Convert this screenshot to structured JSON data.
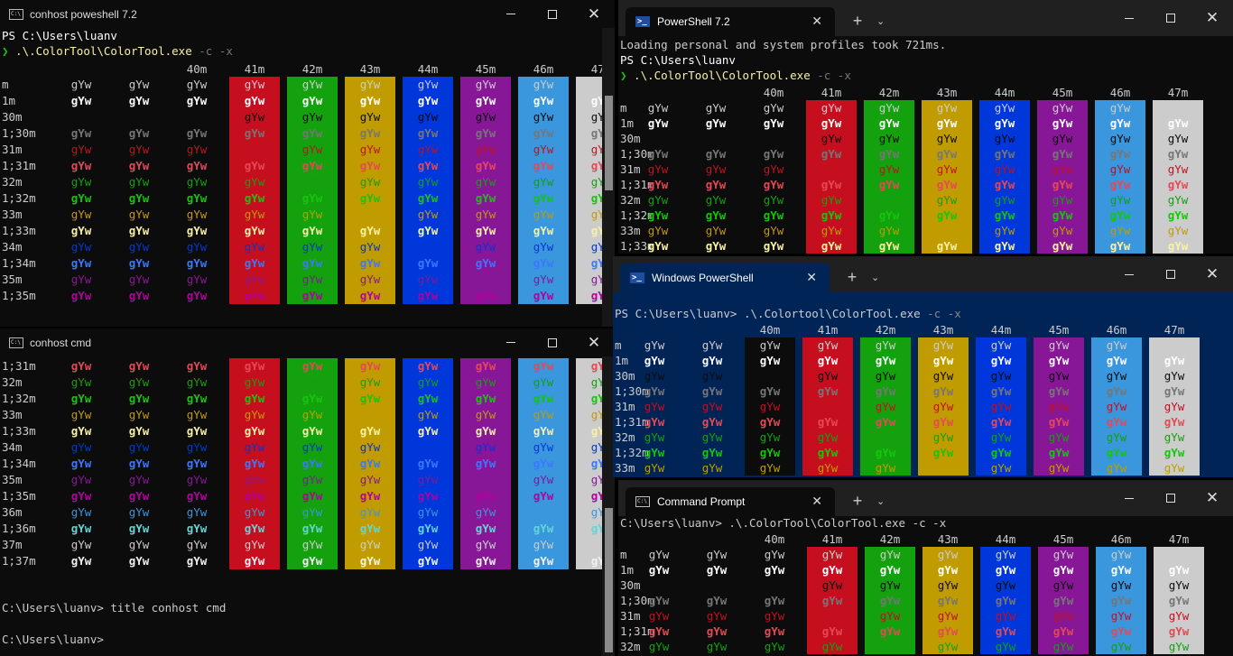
{
  "colors": {
    "fg": [
      "#0c0c0c",
      "#c50f1f",
      "#13a10e",
      "#c19c00",
      "#0037da",
      "#881798",
      "#3a96dd",
      "#cccccc"
    ],
    "bright": [
      "#767676",
      "#e74856",
      "#16c60c",
      "#f9f1a5",
      "#3b78ff",
      "#b4009e",
      "#61d6d6",
      "#f2f2f2"
    ],
    "bg": [
      "#0c0c0c",
      "#c50f1f",
      "#13a10e",
      "#c19c00",
      "#0037da",
      "#881798",
      "#3a96dd",
      "#cccccc"
    ],
    "ps_blue": "#012456"
  },
  "sample": "gYw",
  "bg_headers": [
    "40m",
    "41m",
    "42m",
    "43m",
    "44m",
    "45m",
    "46m",
    "47m"
  ],
  "all_rows": [
    "m",
    "1m",
    "30m",
    "1;30m",
    "31m",
    "1;31m",
    "32m",
    "1;32m",
    "33m",
    "1;33m",
    "34m",
    "1;34m",
    "35m",
    "1;35m",
    "36m",
    "1;36m",
    "37m",
    "1;37m"
  ],
  "win1": {
    "title": "conhost poweshell 7.2",
    "prompt": "PS C:\\Users\\luanv",
    "cmd_arrow": "❯",
    "cmd_exe": " .\\.ColorTool\\ColorTool.exe",
    "cmd_args": " -c -x"
  },
  "win2": {
    "title": "conhost cmd",
    "prompt_title": "C:\\Users\\luanv> title conhost cmd",
    "prompt_end": "C:\\Users\\luanv>"
  },
  "win3": {
    "tab_title": "PowerShell 7.2",
    "line1": "Loading personal and system profiles took 721ms.",
    "prompt": "PS C:\\Users\\luanv",
    "cmd_arrow": "❯",
    "cmd_exe": " .\\.ColorTool\\ColorTool.exe",
    "cmd_args": " -c -x"
  },
  "win4": {
    "tab_title": "Windows PowerShell",
    "prompt": "PS C:\\Users\\luanv> .\\.Colortool\\ColorTool.exe",
    "args": " -c -x"
  },
  "win5": {
    "tab_title": "Command Prompt",
    "prompt": "C:\\Users\\luanv> .\\.ColorTool\\ColorTool.exe -c -x"
  },
  "tabbar": {
    "new_tab": "+",
    "dropdown": "⌄",
    "close": "✕"
  }
}
